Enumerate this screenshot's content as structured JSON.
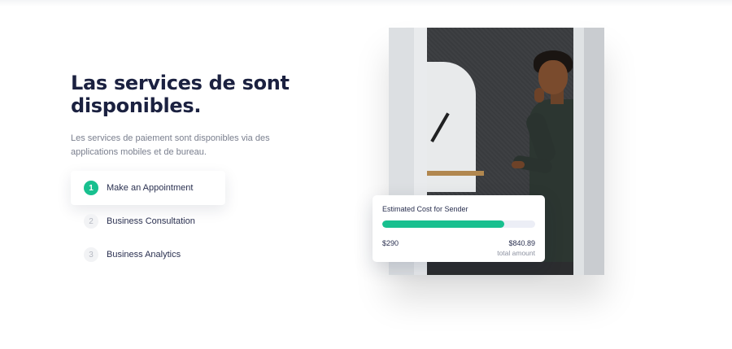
{
  "hero": {
    "title_before": "Las",
    "title_highlight": "services",
    "title_after": "de sont",
    "title_line2": "disponibles.",
    "description": "Les services de paiement sont disponibles via des applications mobiles et de bureau."
  },
  "steps": [
    {
      "number": "1",
      "label": "Make an Appointment",
      "active": true
    },
    {
      "number": "2",
      "label": "Business Consultation",
      "active": false
    },
    {
      "number": "3",
      "label": "Business Analytics",
      "active": false
    }
  ],
  "cost_card": {
    "title": "Estimated Cost for Sender",
    "progress": 0.8,
    "left_amount": "$290",
    "right_amount": "$840.89",
    "right_caption": "total amount"
  },
  "colors": {
    "accent": "#18c08f",
    "title": "#1b2140",
    "highlight": "#d5dcf4"
  }
}
